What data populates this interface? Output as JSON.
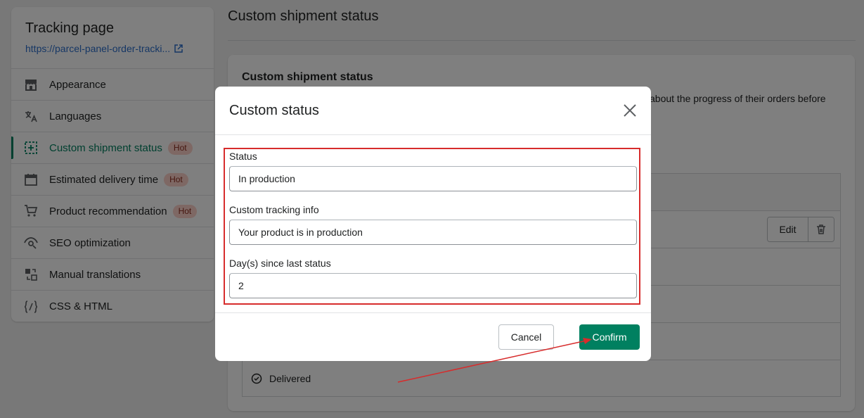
{
  "sidebar": {
    "title": "Tracking page",
    "link": "https://parcel-panel-order-tracki...",
    "items": [
      {
        "label": "Appearance",
        "icon": "store-icon"
      },
      {
        "label": "Languages",
        "icon": "translate-icon"
      },
      {
        "label": "Custom shipment status",
        "icon": "custom-status-icon",
        "badge": "Hot"
      },
      {
        "label": "Estimated delivery time",
        "icon": "calendar-icon",
        "badge": "Hot"
      },
      {
        "label": "Product recommendation",
        "icon": "cart-icon",
        "badge": "Hot"
      },
      {
        "label": "SEO optimization",
        "icon": "eye-icon"
      },
      {
        "label": "Manual translations",
        "icon": "swap-icon"
      },
      {
        "label": "CSS & HTML",
        "icon": "code-icon"
      }
    ]
  },
  "main": {
    "title": "Custom shipment status",
    "card_title": "Custom shipment status",
    "card_desc": "about the progress of their orders before",
    "edit_label": "Edit",
    "delivered_label": "Delivered"
  },
  "modal": {
    "title": "Custom status",
    "fields": [
      {
        "label": "Status",
        "value": "In production"
      },
      {
        "label": "Custom tracking info",
        "value": "Your product is in production"
      },
      {
        "label": "Day(s) since last status",
        "value": "2"
      }
    ],
    "cancel_label": "Cancel",
    "confirm_label": "Confirm"
  },
  "colors": {
    "accent": "#008060",
    "link": "#2c6ecb",
    "badge_bg": "#fdd1c8",
    "highlight": "#d72c2c"
  }
}
